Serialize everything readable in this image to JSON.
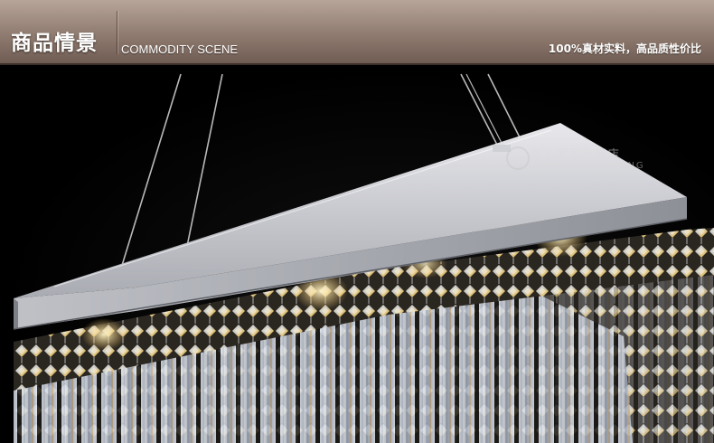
{
  "header": {
    "title_cn": "商品情景",
    "title_en": "COMMODITY SCENE",
    "slogan": "100%真材实料，高品质性价比"
  },
  "watermark": {
    "brand_cn": "乾心家居旗舰店",
    "brand_en": "QIANXIN LIGHTING"
  },
  "image": {
    "subject": "rectangular-crystal-chandelier-icon",
    "colors": {
      "header_top": "#b8a59a",
      "header_bottom": "#6f5c52",
      "frame": "#c9c9cc",
      "crystal_warm": "#e8c878",
      "crystal_cool": "#cfd8e6"
    }
  }
}
